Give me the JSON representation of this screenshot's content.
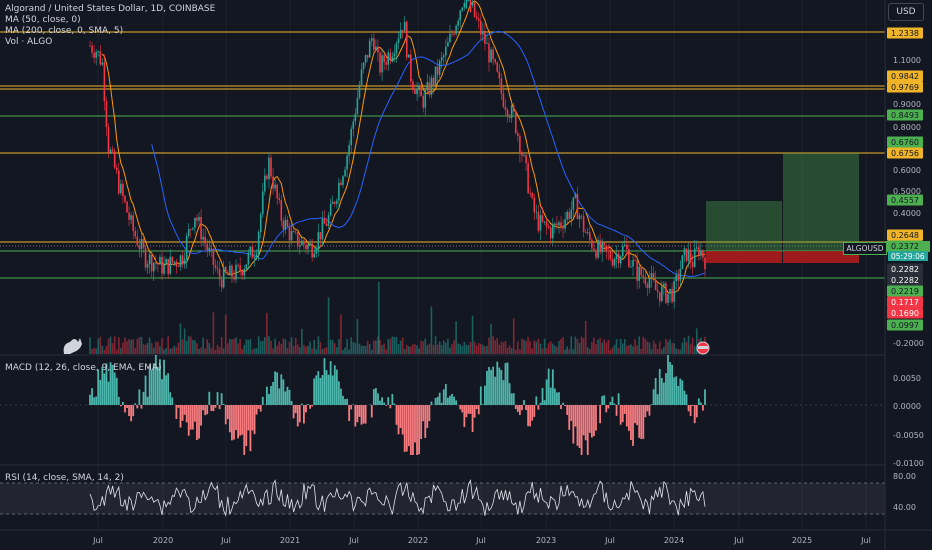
{
  "header": {
    "symbol_line": "Algorand / United States Dollar, 1D, COINBASE",
    "ma50": "MA (50, close, 0)",
    "ma200": "MA (200, close, 0, SMA, 5)",
    "vol": "Vol · ALGO"
  },
  "currency_button": "USD",
  "symbol_tag": "ALGOUSD",
  "countdown": "05:29:06",
  "macd_label": "MACD (12, 26, close, 9, EMA, EMA)",
  "rsi_label": "RSI (14, close, SMA, 14, 2)",
  "colors": {
    "bg": "#131722",
    "orange": "#f0b429",
    "green": "#4caf50",
    "red": "#f23645",
    "teal": "#26a69a",
    "ma_orange": "#ff9800",
    "ma_blue": "#2962ff",
    "rsi_line": "#e0e3eb",
    "macd_pos": "#4db6ac",
    "macd_neg": "#f77c80"
  },
  "chart_data": {
    "type": "candlestick",
    "symbol": "ALGOUSD",
    "exchange": "COINBASE",
    "timeframe": "1D",
    "x_ticks": [
      "Jul",
      "2020",
      "Jul",
      "2021",
      "Jul",
      "2022",
      "Jul",
      "2023",
      "Jul",
      "2024",
      "Jul",
      "2025",
      "Jul"
    ],
    "price_scale_ticks": [
      "1.1000",
      "1.0000",
      "0.9000",
      "0.8000",
      "0.6000",
      "0.5000",
      "0.4000",
      "-0.2000"
    ],
    "horizontal_levels": [
      {
        "label": "1.2338",
        "value": 1.2338,
        "color": "orange"
      },
      {
        "label": "0.9842",
        "value": 0.9842,
        "color": "orange"
      },
      {
        "label": "0.9769",
        "value": 0.9769,
        "color": "orange"
      },
      {
        "label": "0.8493",
        "value": 0.8493,
        "color": "green"
      },
      {
        "label": "0.6760",
        "value": 0.676,
        "color": "green"
      },
      {
        "label": "0.6756",
        "value": 0.6756,
        "color": "orange"
      },
      {
        "label": "0.4557",
        "value": 0.4557,
        "color": "green"
      },
      {
        "label": "0.2648",
        "value": 0.2648,
        "color": "orange"
      },
      {
        "label": "0.2372",
        "value": 0.2372,
        "color": "green"
      },
      {
        "label": "0.2282",
        "value": 0.2282,
        "color": "dark"
      },
      {
        "label": "0.2282",
        "value": 0.2282,
        "color": "dark"
      },
      {
        "label": "0.2219",
        "value": 0.2219,
        "color": "green"
      },
      {
        "label": "0.1717",
        "value": 0.1717,
        "color": "red"
      },
      {
        "label": "0.1690",
        "value": 0.169,
        "color": "red"
      },
      {
        "label": "0.0997",
        "value": 0.0997,
        "color": "green"
      }
    ],
    "macd_ticks": [
      "0.0050",
      "0.0000",
      "-0.0050",
      "-0.0100"
    ],
    "rsi_ticks": [
      "80.00",
      "40.00"
    ],
    "price_path": [
      [
        0.0,
        1.45
      ],
      [
        0.01,
        1.4
      ],
      [
        0.02,
        1.25
      ],
      [
        0.03,
        0.62
      ],
      [
        0.05,
        0.42
      ],
      [
        0.07,
        0.3
      ],
      [
        0.09,
        0.24
      ],
      [
        0.12,
        0.22
      ],
      [
        0.15,
        0.24
      ],
      [
        0.17,
        0.35
      ],
      [
        0.19,
        0.26
      ],
      [
        0.21,
        0.2
      ],
      [
        0.24,
        0.21
      ],
      [
        0.27,
        0.26
      ],
      [
        0.29,
        0.55
      ],
      [
        0.31,
        0.34
      ],
      [
        0.33,
        0.28
      ],
      [
        0.36,
        0.26
      ],
      [
        0.39,
        0.34
      ],
      [
        0.42,
        0.6
      ],
      [
        0.44,
        1.1
      ],
      [
        0.46,
        1.6
      ],
      [
        0.47,
        1.2
      ],
      [
        0.49,
        1.4
      ],
      [
        0.51,
        1.8
      ],
      [
        0.52,
        1.15
      ],
      [
        0.54,
        0.9
      ],
      [
        0.56,
        1.1
      ],
      [
        0.58,
        1.4
      ],
      [
        0.6,
        1.95
      ],
      [
        0.61,
        2.3
      ],
      [
        0.63,
        1.75
      ],
      [
        0.64,
        1.55
      ],
      [
        0.66,
        1.15
      ],
      [
        0.67,
        0.95
      ],
      [
        0.69,
        0.78
      ],
      [
        0.7,
        0.62
      ],
      [
        0.71,
        0.48
      ],
      [
        0.72,
        0.36
      ],
      [
        0.73,
        0.32
      ],
      [
        0.75,
        0.3
      ],
      [
        0.77,
        0.33
      ],
      [
        0.79,
        0.38
      ],
      [
        0.8,
        0.32
      ],
      [
        0.81,
        0.28
      ],
      [
        0.83,
        0.25
      ],
      [
        0.85,
        0.24
      ],
      [
        0.87,
        0.26
      ],
      [
        0.88,
        0.23
      ],
      [
        0.89,
        0.21
      ],
      [
        0.91,
        0.2
      ],
      [
        0.92,
        0.18
      ],
      [
        0.94,
        0.175
      ],
      [
        0.95,
        0.18
      ],
      [
        0.96,
        0.22
      ],
      [
        0.97,
        0.25
      ],
      [
        0.98,
        0.23
      ],
      [
        0.99,
        0.26
      ],
      [
        1.0,
        0.2372
      ]
    ]
  }
}
